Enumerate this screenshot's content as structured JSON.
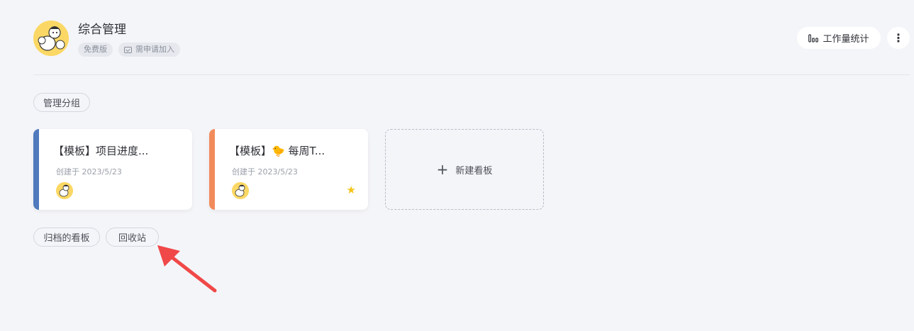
{
  "workspace": {
    "title": "综合管理",
    "plan_tag": "免费版",
    "join_tag": "需申请加入"
  },
  "toolbar": {
    "stats_label": "工作量统计",
    "more_label": "⋮"
  },
  "groups": {
    "manage_label": "管理分组",
    "archived_label": "归档的看板",
    "recycle_label": "回收站"
  },
  "boards": [
    {
      "title": "【模板】项目进度...",
      "created": "创建于 2023/5/23",
      "accent": "#4f7bbd",
      "starred": false
    },
    {
      "title": "【模板】🐤 每周T...",
      "created": "创建于 2023/5/23",
      "accent": "#f28b5c",
      "starred": true
    }
  ],
  "new_board": {
    "icon": "+",
    "label": "新建看板"
  },
  "colors": {
    "background": "#f4f5f9",
    "avatar": "#fbd865",
    "star": "#f5c518",
    "annotation_arrow": "#f04848"
  }
}
